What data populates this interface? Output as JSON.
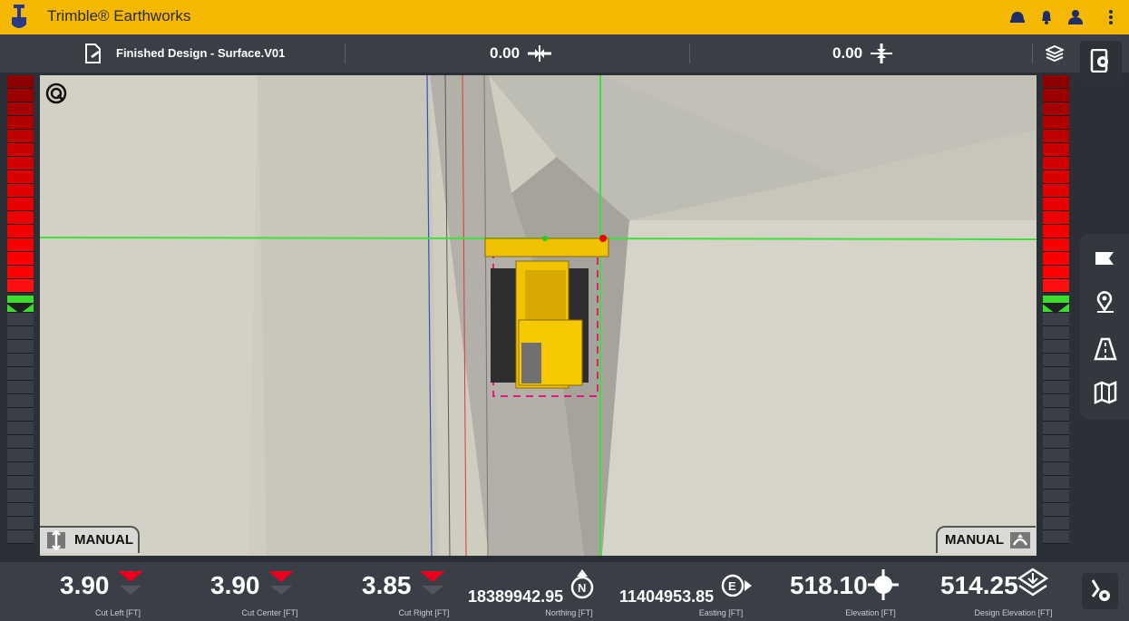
{
  "app": {
    "title": "Trimble® Earthworks"
  },
  "topbar": {
    "icons": [
      "helmet-icon",
      "bell-icon",
      "person-icon",
      "kebab-menu-icon"
    ]
  },
  "infobar": {
    "design_name": "Finished Design - Surface.V01",
    "horizontal_offset": "0.00",
    "vertical_offset": "0.00"
  },
  "viewport": {
    "left_mode": "MANUAL",
    "right_mode": "MANUAL"
  },
  "bottombar": {
    "cut_left": {
      "value": "3.90",
      "label": "Cut Left [FT]"
    },
    "cut_center": {
      "value": "3.90",
      "label": "Cut Center [FT]"
    },
    "cut_right": {
      "value": "3.85",
      "label": "Cut Right [FT]"
    },
    "northing": {
      "value": "18389942.95",
      "label": "Northing [FT]"
    },
    "easting": {
      "value": "11404953.85",
      "label": "Easting [FT]"
    },
    "elevation": {
      "value": "518.10",
      "label": "Elevation [FT]"
    },
    "design_elevation": {
      "value": "514.25",
      "label": "Design Elevation [FT]"
    }
  },
  "colors": {
    "brand": "#f5b800",
    "cut": "#e8001c",
    "ongrade": "#3cdc2e",
    "panel": "#3a3f47"
  }
}
